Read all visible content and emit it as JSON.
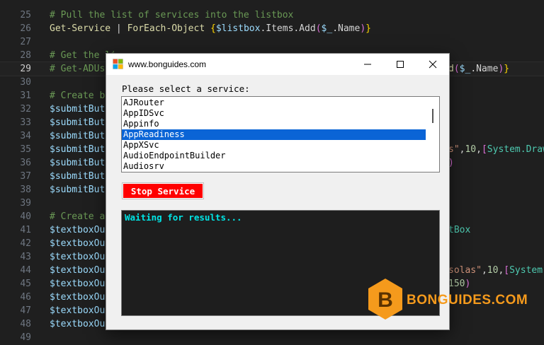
{
  "editor": {
    "lines": [
      {
        "n": "25",
        "segments": [
          {
            "c": "tok-comment",
            "t": "# Pull the list of services into the listbox"
          }
        ]
      },
      {
        "n": "26",
        "segments": [
          {
            "c": "tok-cmd",
            "t": "Get-Service"
          },
          {
            "c": "",
            "t": " | "
          },
          {
            "c": "tok-cmd",
            "t": "ForEach-Object"
          },
          {
            "c": "",
            "t": " "
          },
          {
            "c": "tok-brace",
            "t": "{"
          },
          {
            "c": "tok-var",
            "t": "$listbox"
          },
          {
            "c": "",
            "t": ".Items.Add"
          },
          {
            "c": "tok-paren",
            "t": "("
          },
          {
            "c": "tok-var",
            "t": "$_"
          },
          {
            "c": "",
            "t": ".Name"
          },
          {
            "c": "tok-paren",
            "t": ")"
          },
          {
            "c": "tok-brace",
            "t": "}"
          }
        ]
      },
      {
        "n": "27",
        "segments": []
      },
      {
        "n": "28",
        "segments": [
          {
            "c": "tok-comment",
            "t": "# Get the li"
          }
        ]
      },
      {
        "n": "29",
        "active": true,
        "segments": [
          {
            "c": "tok-comment",
            "t": "# Get-ADUs"
          }
        ]
      },
      {
        "n": "30",
        "segments": []
      },
      {
        "n": "31",
        "segments": [
          {
            "c": "tok-comment",
            "t": "# Create b"
          }
        ]
      },
      {
        "n": "32",
        "segments": [
          {
            "c": "tok-var",
            "t": "$submitButt"
          }
        ]
      },
      {
        "n": "33",
        "segments": [
          {
            "c": "tok-var",
            "t": "$submitButt"
          }
        ]
      },
      {
        "n": "34",
        "segments": [
          {
            "c": "tok-var",
            "t": "$submitButt"
          }
        ]
      },
      {
        "n": "35",
        "segments": [
          {
            "c": "tok-var",
            "t": "$submitButt"
          }
        ]
      },
      {
        "n": "36",
        "segments": [
          {
            "c": "tok-var",
            "t": "$submitButt"
          }
        ]
      },
      {
        "n": "37",
        "segments": [
          {
            "c": "tok-var",
            "t": "$submitButt"
          }
        ]
      },
      {
        "n": "38",
        "segments": [
          {
            "c": "tok-var",
            "t": "$submitButt"
          }
        ]
      },
      {
        "n": "39",
        "segments": []
      },
      {
        "n": "40",
        "segments": [
          {
            "c": "tok-comment",
            "t": "# Create a"
          }
        ]
      },
      {
        "n": "41",
        "segments": [
          {
            "c": "tok-var",
            "t": "$textboxOut"
          }
        ]
      },
      {
        "n": "42",
        "segments": [
          {
            "c": "tok-var",
            "t": "$textboxOut"
          }
        ]
      },
      {
        "n": "43",
        "segments": [
          {
            "c": "tok-var",
            "t": "$textboxOut"
          }
        ]
      },
      {
        "n": "44",
        "segments": [
          {
            "c": "tok-var",
            "t": "$textboxOut"
          }
        ]
      },
      {
        "n": "45",
        "segments": [
          {
            "c": "tok-var",
            "t": "$textboxOut"
          }
        ]
      },
      {
        "n": "46",
        "segments": [
          {
            "c": "tok-var",
            "t": "$textboxOut"
          }
        ]
      },
      {
        "n": "47",
        "segments": [
          {
            "c": "tok-var",
            "t": "$textboxOut"
          }
        ]
      },
      {
        "n": "48",
        "segments": [
          {
            "c": "tok-var",
            "t": "$textboxOut"
          }
        ]
      },
      {
        "n": "49",
        "segments": []
      }
    ],
    "right_fragments": [
      {
        "line": "29",
        "segments": [
          {
            "c": "tok-cmd",
            "t": "d"
          },
          {
            "c": "tok-paren",
            "t": "("
          },
          {
            "c": "tok-var",
            "t": "$_"
          },
          {
            "c": "",
            "t": ".Name"
          },
          {
            "c": "tok-paren",
            "t": ")"
          },
          {
            "c": "tok-brace",
            "t": "}"
          }
        ]
      },
      {
        "line": "35",
        "segments": [
          {
            "c": "tok-str",
            "t": "s\""
          },
          {
            "c": "",
            "t": ","
          },
          {
            "c": "tok-num",
            "t": "10"
          },
          {
            "c": "",
            "t": ","
          },
          {
            "c": "tok-paren",
            "t": "["
          },
          {
            "c": "tok-type",
            "t": "System.Draw"
          }
        ]
      },
      {
        "line": "36",
        "segments": [
          {
            "c": "tok-paren",
            "t": ")"
          }
        ]
      },
      {
        "line": "41",
        "segments": [
          {
            "c": "tok-type",
            "t": "tBox"
          }
        ]
      },
      {
        "line": "44",
        "segments": [
          {
            "c": "tok-str",
            "t": "solas\""
          },
          {
            "c": "",
            "t": ","
          },
          {
            "c": "tok-num",
            "t": "10"
          },
          {
            "c": "",
            "t": ","
          },
          {
            "c": "tok-paren",
            "t": "["
          },
          {
            "c": "tok-type",
            "t": "System."
          }
        ]
      },
      {
        "line": "45",
        "segments": [
          {
            "c": "tok-num",
            "t": "150"
          },
          {
            "c": "tok-paren",
            "t": ")"
          }
        ]
      }
    ]
  },
  "dialog": {
    "title": "www.bonguides.com",
    "prompt": "Please select a service:",
    "services": [
      "AJRouter",
      "AppIDSvc",
      "Appinfo",
      "AppReadiness",
      "AppXSvc",
      "AudioEndpointBuilder",
      "Audiosrv"
    ],
    "selected_service": "AppReadiness",
    "stop_button_label": "Stop Service",
    "output_text": "Waiting for results...",
    "colors": {
      "stop_button": "#ff0000",
      "selection": "#0a64d6",
      "output_bg": "#1e1e1e",
      "output_text": "#00e5e5"
    }
  },
  "watermark": {
    "text": "BONGUIDES.COM",
    "logo_letter": "B",
    "color": "#f59a1c"
  }
}
